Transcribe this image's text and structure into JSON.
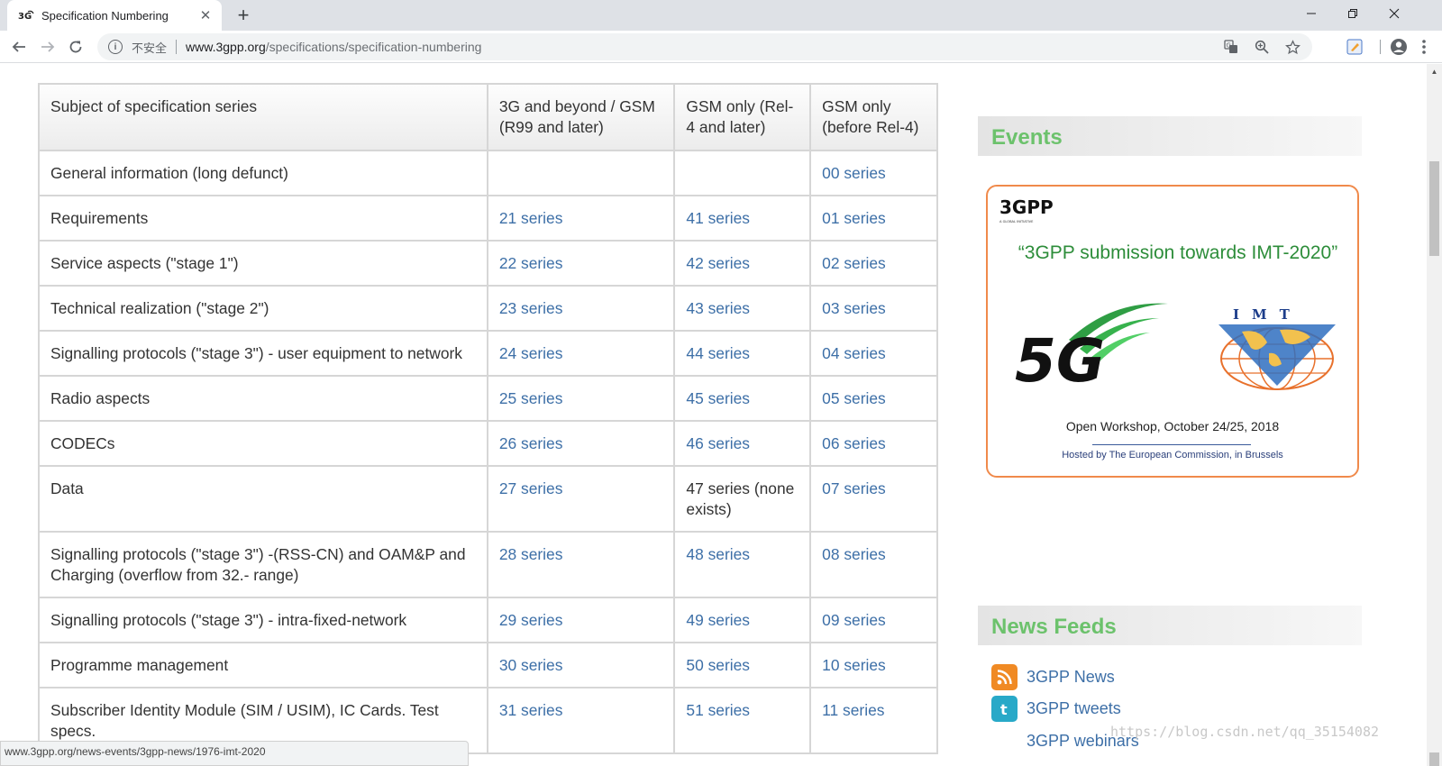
{
  "browser": {
    "tab_title": "Specification Numbering",
    "security_label": "不安全",
    "url_host": "www.3gpp.org",
    "url_path": "/specifications/specification-numbering"
  },
  "table": {
    "headers": [
      "Subject of specification series",
      "3G and beyond / GSM (R99 and later)",
      "GSM only (Rel-4 and later)",
      "GSM only (before Rel-4)"
    ],
    "rows": [
      {
        "subject": "General information (long defunct)",
        "c2": "",
        "c3": "",
        "c4": "00 series"
      },
      {
        "subject": "Requirements",
        "c2": "21 series",
        "c3": "41 series",
        "c4": "01 series"
      },
      {
        "subject": "Service aspects (\"stage 1\")",
        "c2": "22 series",
        "c3": "42 series",
        "c4": "02 series"
      },
      {
        "subject": "Technical realization (\"stage 2\")",
        "c2": "23 series",
        "c3": "43 series",
        "c4": "03 series"
      },
      {
        "subject": "Signalling protocols (\"stage 3\") - user equipment to network",
        "c2": "24 series",
        "c3": "44 series",
        "c4": "04 series"
      },
      {
        "subject": "Radio aspects",
        "c2": "25 series",
        "c3": "45 series",
        "c4": "05 series"
      },
      {
        "subject": "CODECs",
        "c2": "26 series",
        "c3": "46 series",
        "c4": "06 series"
      },
      {
        "subject": "Data",
        "c2": "27 series",
        "c3": "47 series (none exists)",
        "c4": "07 series"
      },
      {
        "subject": "Signalling protocols (\"stage 3\") -(RSS-CN) and OAM&P and Charging (overflow from 32.- range)",
        "c2": "28 series",
        "c3": "48 series",
        "c4": "08 series"
      },
      {
        "subject": "Signalling protocols (\"stage 3\") - intra-fixed-network",
        "c2": "29 series",
        "c3": "49 series",
        "c4": "09 series"
      },
      {
        "subject": "Programme management",
        "c2": "30 series",
        "c3": "50 series",
        "c4": "10 series"
      },
      {
        "subject": "Subscriber Identity Module (SIM / USIM), IC Cards. Test specs.",
        "c2": "31 series",
        "c3": "51 series",
        "c4": "11 series"
      }
    ]
  },
  "sidebar": {
    "events_title": "Events",
    "banner": {
      "logo_text": "3GPP",
      "logo_tagline": "A GLOBAL INITIATIVE",
      "heading": "“3GPP submission towards IMT-2020”",
      "logo_5g": "5G",
      "logo_imt": "IMT",
      "workshop": "Open Workshop, October 24/25, 2018",
      "hosted": "Hosted by The European Commission, in Brussels"
    },
    "news_title": "News Feeds",
    "feeds": [
      {
        "label": "3GPP News"
      },
      {
        "label": "3GPP tweets"
      },
      {
        "label": "3GPP webinars"
      }
    ]
  },
  "status_bar_url": "www.3gpp.org/news-events/3gpp-news/1976-imt-2020",
  "watermark": "https://blog.csdn.net/qq_35154082",
  "colors": {
    "link": "#3d6fa7",
    "sidebar_title": "#6cc26c",
    "banner_border": "#f08a4b"
  }
}
